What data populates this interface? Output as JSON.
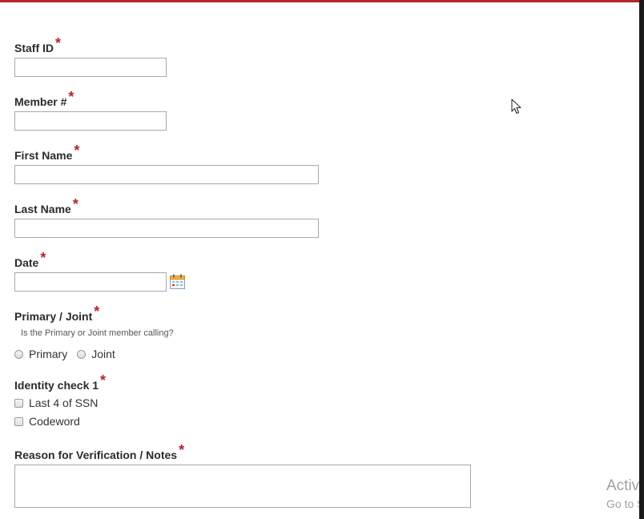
{
  "form": {
    "staff_id": {
      "label": "Staff ID",
      "required": "*",
      "value": ""
    },
    "member_no": {
      "label": "Member #",
      "required": "*",
      "value": ""
    },
    "first_name": {
      "label": "First Name",
      "required": "*",
      "value": ""
    },
    "last_name": {
      "label": "Last Name",
      "required": "*",
      "value": ""
    },
    "date": {
      "label": "Date",
      "required": "*",
      "value": "",
      "icon": "calendar-icon"
    },
    "primary_joint": {
      "label": "Primary / Joint",
      "required": "*",
      "help": "Is the Primary or Joint member calling?",
      "options": [
        "Primary",
        "Joint"
      ]
    },
    "identity_check": {
      "label": "Identity check 1",
      "required": "*",
      "options": [
        "Last 4 of SSN",
        "Codeword"
      ]
    },
    "reason": {
      "label": "Reason for Verification / Notes",
      "required": "*",
      "value": ""
    }
  },
  "watermark": {
    "line1": "Activate Windows",
    "line2": "Go to Settings to activate Windows."
  },
  "colors": {
    "accent": "#b2262e",
    "border": "#a9a9a9",
    "label": "#2b2b2b"
  }
}
